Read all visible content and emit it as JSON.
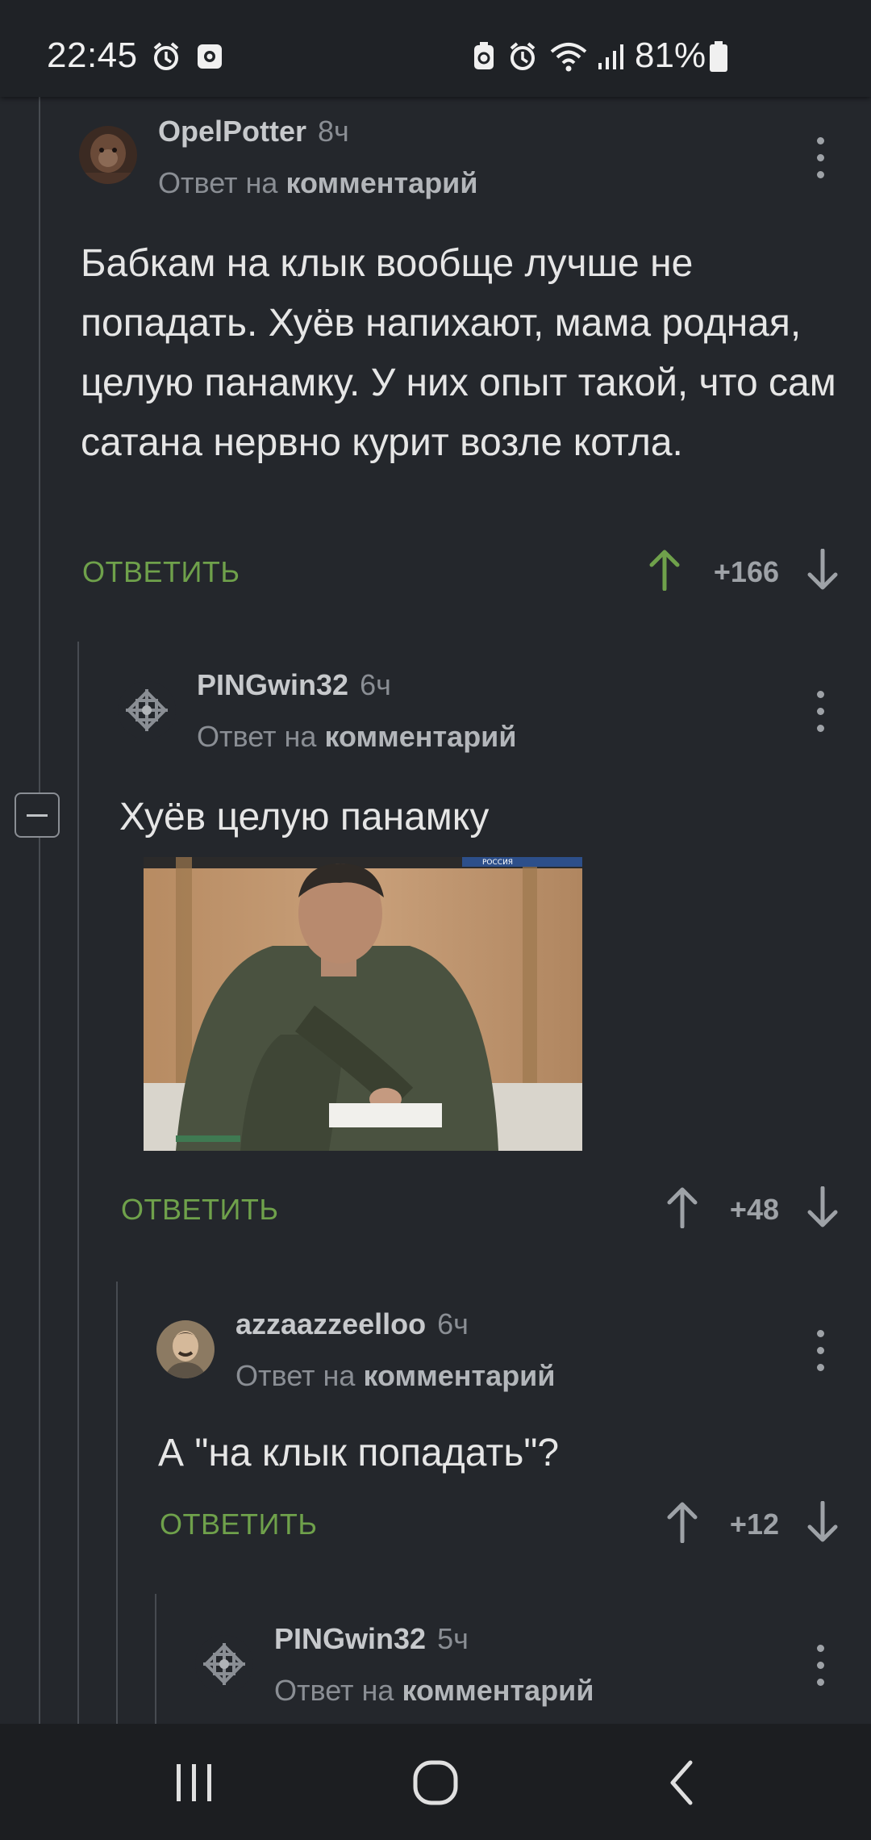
{
  "status_bar": {
    "time": "22:45",
    "battery_percent": "81%",
    "icons": [
      "alarm-icon",
      "screen-record-icon",
      "recycle-icon",
      "alarm-icon",
      "wifi-icon",
      "signal-icon",
      "battery-icon"
    ]
  },
  "reply_prefix": "Ответ на",
  "reply_target": "комментарий",
  "reply_label": "ОТВЕТИТЬ",
  "comments": [
    {
      "username": "OpelPotter",
      "time": "8ч",
      "text": "Бабкам на клык вообще лучше не попадать. Хуёв напихают, мама родная, целую панамку. У них опыт такой, что сам сатана нервно курит возле котла.",
      "score": "+166",
      "upvoted": true
    },
    {
      "username": "PINGwin32",
      "time": "6ч",
      "text": "Хуёв целую панамку",
      "has_image": true,
      "score": "+48",
      "upvoted": false
    },
    {
      "username": "azzaazzeelloo",
      "time": "6ч",
      "text": "А \"на клык попадать\"?",
      "score": "+12",
      "upvoted": false
    },
    {
      "username": "PINGwin32",
      "time": "5ч"
    }
  ],
  "gif": {
    "channel_logo_text": "РОССИЯ"
  },
  "colors": {
    "background": "#24272c",
    "reply_green": "#6fa14b",
    "upvote_green": "#6fa14b",
    "muted": "#8a8e94"
  },
  "nav_bar": {
    "buttons": [
      "recent-apps",
      "home",
      "back"
    ]
  }
}
